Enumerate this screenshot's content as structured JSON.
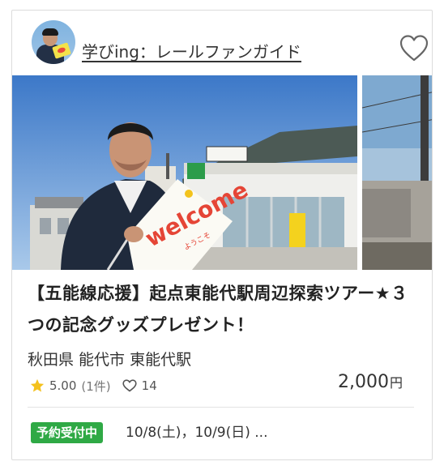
{
  "author": {
    "name": "学びing：レールファンガイド"
  },
  "photo": {
    "flag_text": "welcome",
    "flag_subtext": "ようこそ"
  },
  "title": "【五能線応援】起点東能代駅周辺探索ツアー★３つの記念グッズプレゼント！",
  "location": "秋田県 能代市 東能代駅",
  "rating": {
    "value": "5.00",
    "count": "(1件)"
  },
  "favorites": "14",
  "price": {
    "amount": "2,000",
    "unit": "円"
  },
  "status_badge": "予約受付中",
  "dates": "10/8(土)，10/9(日) ...",
  "icons": {
    "favorite": "heart-outline-icon",
    "star": "star-icon",
    "likes": "heart-small-icon"
  },
  "colors": {
    "badge": "#2fa945",
    "star": "#f4c11d"
  }
}
